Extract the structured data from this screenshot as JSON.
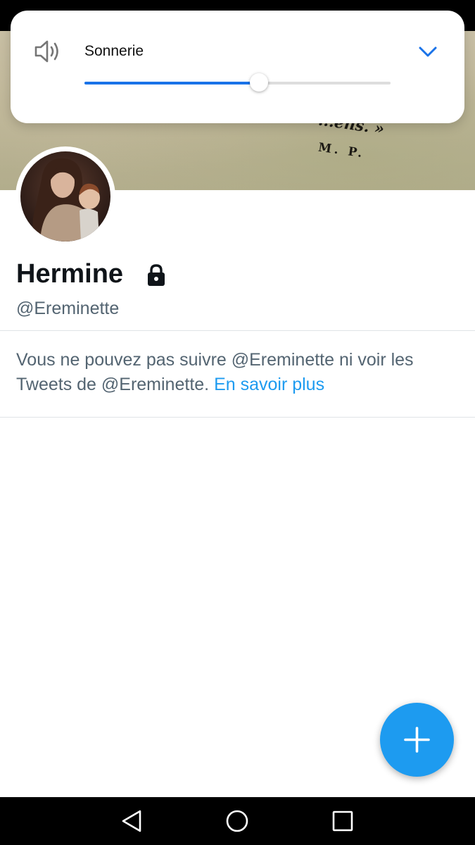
{
  "volume_dialog": {
    "label": "Sonnerie",
    "icon": "speaker-icon",
    "level_percent": 57,
    "accent_color": "#1a73e8"
  },
  "banner": {
    "quote_fragment": "...ens. »",
    "signature": "M. P."
  },
  "profile": {
    "display_name": "Hermine",
    "handle": "@Ereminette",
    "protected_icon": "lock-icon"
  },
  "notice": {
    "text": "Vous ne pouvez pas suivre @Ereminette ni voir les Tweets de @Ereminette. ",
    "link_text": "En savoir plus",
    "link_color": "#1d9bf0"
  },
  "fab": {
    "icon": "plus-icon",
    "color": "#1d9bf0"
  },
  "nav_bar": {
    "buttons": [
      "back",
      "home",
      "recents"
    ]
  }
}
